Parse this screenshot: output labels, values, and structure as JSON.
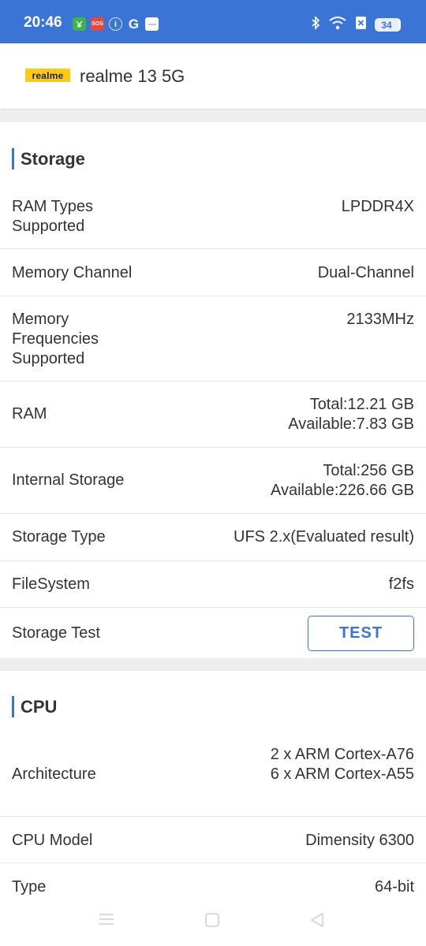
{
  "status_bar": {
    "time": "20:46",
    "notification_icons": [
      "wallet-icon",
      "sos-icon",
      "info-icon",
      "google-icon",
      "app-icon"
    ],
    "notif_labels": {
      "sos": "SOS",
      "google": "G",
      "info": "i"
    },
    "battery_level": "34"
  },
  "header": {
    "brand_logo_text": "realme",
    "device_name": "realme 13 5G"
  },
  "storage": {
    "title": "Storage",
    "rows": [
      {
        "label": "RAM Types Supported",
        "value": "LPDDR4X"
      },
      {
        "label": "Memory Channel",
        "value": "Dual-Channel"
      },
      {
        "label": "Memory Frequencies Supported",
        "value": "2133MHz"
      },
      {
        "label": "RAM",
        "value_line1": "Total:12.21 GB",
        "value_line2": "Available:7.83 GB"
      },
      {
        "label": "Internal Storage",
        "value_line1": "Total:256 GB",
        "value_line2": "Available:226.66 GB"
      },
      {
        "label": "Storage Type",
        "value": "UFS 2.x(Evaluated result)"
      },
      {
        "label": "FileSystem",
        "value": "f2fs"
      },
      {
        "label": "Storage Test",
        "button": "TEST"
      }
    ]
  },
  "cpu": {
    "title": "CPU",
    "rows": [
      {
        "label": "Architecture",
        "value_line1": "2 x ARM Cortex-A76",
        "value_line2": "6 x ARM Cortex-A55"
      },
      {
        "label": "CPU Model",
        "value": "Dimensity 6300"
      },
      {
        "label": "Type",
        "value": "64-bit"
      }
    ]
  },
  "colors": {
    "accent": "#3a75d6",
    "status_bar": "#3a75d6",
    "brand_yellow": "#ffc915",
    "divider": "#e6e6e6"
  },
  "nav_bar": [
    "menu-icon",
    "home-icon",
    "back-icon"
  ]
}
